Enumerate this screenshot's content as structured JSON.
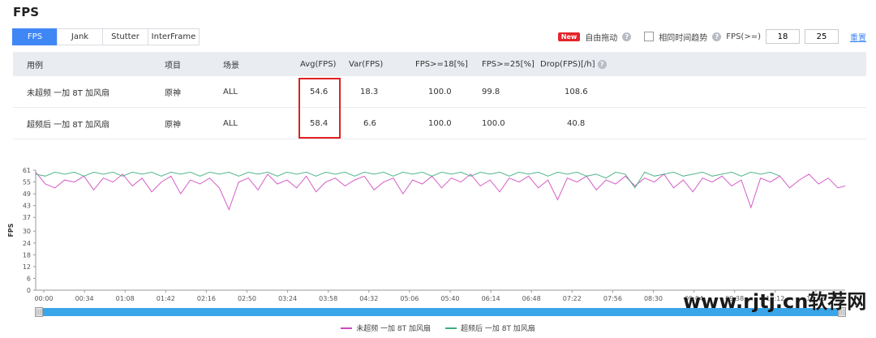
{
  "page_title": "FPS",
  "tabs": [
    {
      "label": "FPS",
      "active": true
    },
    {
      "label": "Jank",
      "active": false
    },
    {
      "label": "Stutter",
      "active": false
    },
    {
      "label": "InterFrame",
      "active": false
    }
  ],
  "toolbar": {
    "new_badge": "New",
    "free_drag_label": "自由拖动",
    "same_time_label": "相同时间趋势",
    "fps_threshold_label": "FPS(>=)",
    "fps_threshold_1": "18",
    "fps_threshold_2": "25",
    "reset_label": "重置"
  },
  "table": {
    "headers": [
      "用例",
      "项目",
      "场景",
      "Avg(FPS)",
      "Var(FPS)",
      "FPS>=18[%]",
      "FPS>=25[%]",
      "Drop(FPS)[/h]"
    ],
    "rows": [
      [
        "未超频 一加 8T 加风扇",
        "原神",
        "ALL",
        "54.6",
        "18.3",
        "100.0",
        "99.8",
        "108.6"
      ],
      [
        "超频后 一加 8T 加风扇",
        "原神",
        "ALL",
        "58.4",
        "6.6",
        "100.0",
        "100.0",
        "40.8"
      ]
    ]
  },
  "colors": {
    "series_1": "#d04ac0",
    "series_2": "#3fae7e",
    "accent": "#3f87f5",
    "highlight": "#e02020"
  },
  "watermark": "www.rjtj.cn软荐网",
  "chart_data": {
    "type": "line",
    "ylabel": "FPS",
    "ylim": [
      0,
      61
    ],
    "yticks": [
      0,
      6,
      12,
      18,
      24,
      30,
      37,
      43,
      49,
      55,
      61
    ],
    "xticks": [
      "00:00",
      "00:34",
      "01:08",
      "01:42",
      "02:16",
      "02:50",
      "03:24",
      "03:58",
      "04:32",
      "05:06",
      "05:40",
      "06:14",
      "06:48",
      "07:22",
      "07:56",
      "08:30",
      "09:04",
      "09:38",
      "10:12",
      "10:46"
    ],
    "xlim_seconds": [
      0,
      670
    ],
    "series": [
      {
        "name": "未超频 一加 8T 加风扇",
        "color": "#d04ac0",
        "points": [
          [
            0,
            60
          ],
          [
            8,
            54
          ],
          [
            16,
            52
          ],
          [
            24,
            56
          ],
          [
            32,
            55
          ],
          [
            40,
            58
          ],
          [
            48,
            51
          ],
          [
            56,
            57
          ],
          [
            64,
            55
          ],
          [
            72,
            59
          ],
          [
            80,
            53
          ],
          [
            88,
            57
          ],
          [
            96,
            50
          ],
          [
            104,
            55
          ],
          [
            112,
            58
          ],
          [
            120,
            49
          ],
          [
            128,
            56
          ],
          [
            136,
            54
          ],
          [
            144,
            57
          ],
          [
            152,
            52
          ],
          [
            160,
            41
          ],
          [
            168,
            55
          ],
          [
            176,
            57
          ],
          [
            184,
            51
          ],
          [
            192,
            59
          ],
          [
            200,
            54
          ],
          [
            208,
            56
          ],
          [
            216,
            52
          ],
          [
            224,
            58
          ],
          [
            232,
            50
          ],
          [
            240,
            55
          ],
          [
            248,
            57
          ],
          [
            256,
            53
          ],
          [
            264,
            56
          ],
          [
            272,
            58
          ],
          [
            280,
            51
          ],
          [
            288,
            55
          ],
          [
            296,
            57
          ],
          [
            304,
            49
          ],
          [
            312,
            56
          ],
          [
            320,
            54
          ],
          [
            328,
            58
          ],
          [
            336,
            52
          ],
          [
            344,
            57
          ],
          [
            352,
            55
          ],
          [
            360,
            59
          ],
          [
            368,
            53
          ],
          [
            376,
            56
          ],
          [
            384,
            50
          ],
          [
            392,
            57
          ],
          [
            400,
            55
          ],
          [
            408,
            58
          ],
          [
            416,
            52
          ],
          [
            424,
            56
          ],
          [
            432,
            46
          ],
          [
            440,
            57
          ],
          [
            448,
            55
          ],
          [
            456,
            58
          ],
          [
            464,
            51
          ],
          [
            472,
            56
          ],
          [
            480,
            54
          ],
          [
            488,
            58
          ],
          [
            496,
            53
          ],
          [
            504,
            57
          ],
          [
            512,
            55
          ],
          [
            520,
            59
          ],
          [
            528,
            52
          ],
          [
            536,
            56
          ],
          [
            544,
            50
          ],
          [
            552,
            57
          ],
          [
            560,
            55
          ],
          [
            568,
            58
          ],
          [
            576,
            53
          ],
          [
            584,
            56
          ],
          [
            592,
            42
          ],
          [
            600,
            57
          ],
          [
            608,
            55
          ],
          [
            616,
            58
          ],
          [
            624,
            52
          ],
          [
            632,
            56
          ],
          [
            640,
            59
          ],
          [
            648,
            54
          ],
          [
            656,
            57
          ],
          [
            664,
            52
          ],
          [
            670,
            53
          ]
        ]
      },
      {
        "name": "超频后 一加 8T 加风扇",
        "color": "#3fae7e",
        "points": [
          [
            0,
            59
          ],
          [
            8,
            58
          ],
          [
            16,
            60
          ],
          [
            24,
            59
          ],
          [
            32,
            60
          ],
          [
            40,
            58
          ],
          [
            48,
            60
          ],
          [
            56,
            59
          ],
          [
            64,
            60
          ],
          [
            72,
            58
          ],
          [
            80,
            60
          ],
          [
            88,
            59
          ],
          [
            96,
            60
          ],
          [
            104,
            58
          ],
          [
            112,
            60
          ],
          [
            120,
            59
          ],
          [
            128,
            60
          ],
          [
            136,
            58
          ],
          [
            144,
            60
          ],
          [
            152,
            59
          ],
          [
            160,
            60
          ],
          [
            168,
            58
          ],
          [
            176,
            60
          ],
          [
            184,
            59
          ],
          [
            192,
            60
          ],
          [
            200,
            58
          ],
          [
            208,
            60
          ],
          [
            216,
            59
          ],
          [
            224,
            60
          ],
          [
            232,
            58
          ],
          [
            240,
            60
          ],
          [
            248,
            59
          ],
          [
            256,
            60
          ],
          [
            264,
            58
          ],
          [
            272,
            60
          ],
          [
            280,
            59
          ],
          [
            288,
            60
          ],
          [
            296,
            58
          ],
          [
            304,
            60
          ],
          [
            312,
            59
          ],
          [
            320,
            60
          ],
          [
            328,
            58
          ],
          [
            336,
            60
          ],
          [
            344,
            59
          ],
          [
            352,
            60
          ],
          [
            360,
            58
          ],
          [
            368,
            60
          ],
          [
            376,
            59
          ],
          [
            384,
            60
          ],
          [
            392,
            58
          ],
          [
            400,
            60
          ],
          [
            408,
            59
          ],
          [
            416,
            60
          ],
          [
            424,
            58
          ],
          [
            432,
            60
          ],
          [
            440,
            59
          ],
          [
            448,
            60
          ],
          [
            456,
            58
          ],
          [
            464,
            59
          ],
          [
            472,
            57
          ],
          [
            480,
            60
          ],
          [
            488,
            59
          ],
          [
            496,
            52
          ],
          [
            504,
            60
          ],
          [
            512,
            58
          ],
          [
            520,
            59
          ],
          [
            528,
            60
          ],
          [
            536,
            58
          ],
          [
            544,
            59
          ],
          [
            552,
            60
          ],
          [
            560,
            58
          ],
          [
            568,
            59
          ],
          [
            576,
            60
          ],
          [
            584,
            58
          ],
          [
            592,
            60
          ],
          [
            600,
            59
          ],
          [
            608,
            60
          ],
          [
            616,
            58
          ]
        ]
      }
    ]
  }
}
